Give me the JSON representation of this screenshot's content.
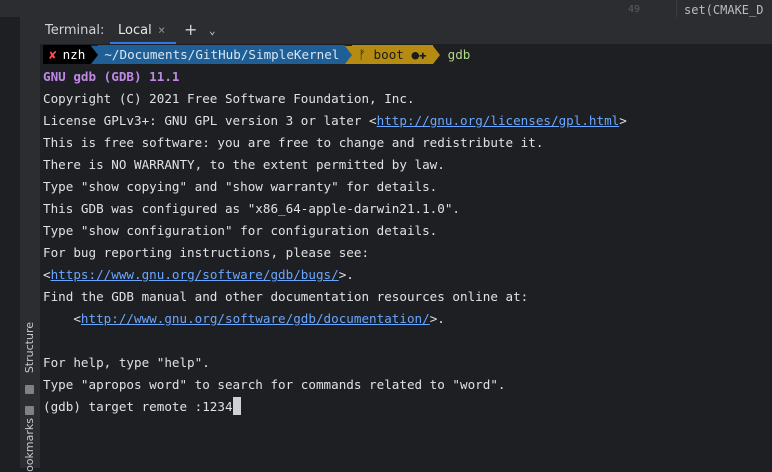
{
  "editor_peek": {
    "line_number": "49",
    "code": "set(CMAKE_D"
  },
  "sidebar": {
    "structure_label": "Structure",
    "bookmarks_label": "ookmarks"
  },
  "terminal": {
    "title": "Terminal:",
    "tab_label": "Local",
    "tab_close": "×",
    "add_tab": "+",
    "more": "⌄"
  },
  "prompt": {
    "status_mark": "✘",
    "user": "nzh",
    "path": "~/Documents/GitHub/SimpleKernel",
    "git_branch": "ᚠ boot ●✚",
    "command": "gdb"
  },
  "output": {
    "l1": "GNU gdb (GDB) 11.1",
    "l2": "Copyright (C) 2021 Free Software Foundation, Inc.",
    "l3_pre": "License GPLv3+: GNU GPL version 3 or later <",
    "l3_link": "http://gnu.org/licenses/gpl.html",
    "l3_post": ">",
    "l4": "This is free software: you are free to change and redistribute it.",
    "l5": "There is NO WARRANTY, to the extent permitted by law.",
    "l6": "Type \"show copying\" and \"show warranty\" for details.",
    "l7": "This GDB was configured as \"x86_64-apple-darwin21.1.0\".",
    "l8": "Type \"show configuration\" for configuration details.",
    "l9": "For bug reporting instructions, please see:",
    "l10_pre": "<",
    "l10_link": "https://www.gnu.org/software/gdb/bugs/",
    "l10_post": ">.",
    "l11": "Find the GDB manual and other documentation resources online at:",
    "l12_pre": "    <",
    "l12_link": "http://www.gnu.org/software/gdb/documentation/",
    "l12_post": ">.",
    "l13": "For help, type \"help\".",
    "l14": "Type \"apropos word\" to search for commands related to \"word\".",
    "l15": "(gdb) target remote :1234"
  },
  "colors": {
    "background": "#1e1f22",
    "path_segment": "#1f5f95",
    "git_segment": "#b58c11",
    "link": "#69a6ff",
    "accent": "#3574f0"
  }
}
